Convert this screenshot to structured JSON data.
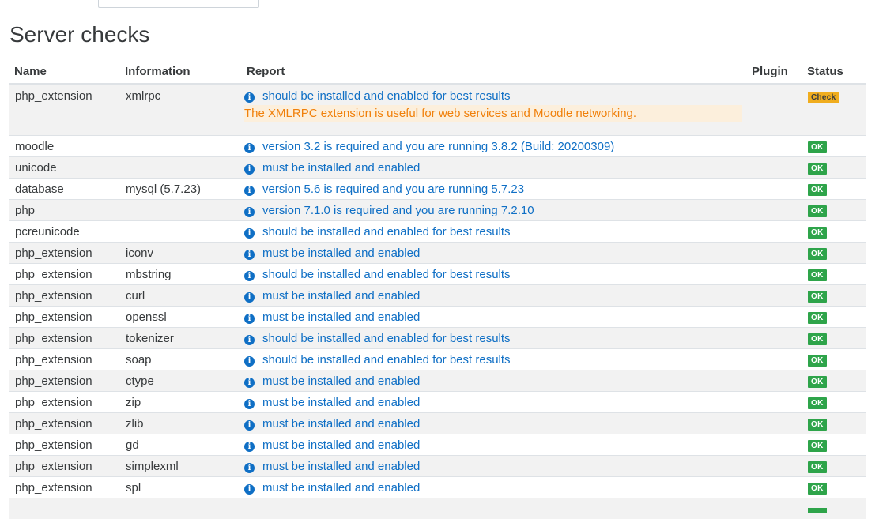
{
  "top": {
    "select_text": ""
  },
  "page_title": "Server checks",
  "table": {
    "headers": {
      "name": "Name",
      "information": "Information",
      "report": "Report",
      "plugin": "Plugin",
      "status": "Status"
    },
    "rows": [
      {
        "name": "php_extension",
        "information": "xmlrpc",
        "report": "should be installed and enabled for best results",
        "note": "The XMLRPC extension is useful for web services and Moodle networking.",
        "status": "Check"
      },
      {
        "name": "moodle",
        "information": "",
        "report": "version 3.2 is required and you are running 3.8.2 (Build: 20200309)",
        "status": "OK"
      },
      {
        "name": "unicode",
        "information": "",
        "report": "must be installed and enabled",
        "status": "OK"
      },
      {
        "name": "database",
        "information": "mysql (5.7.23)",
        "report": "version 5.6 is required and you are running 5.7.23",
        "status": "OK"
      },
      {
        "name": "php",
        "information": "",
        "report": "version 7.1.0 is required and you are running 7.2.10",
        "status": "OK"
      },
      {
        "name": "pcreunicode",
        "information": "",
        "report": "should be installed and enabled for best results",
        "status": "OK"
      },
      {
        "name": "php_extension",
        "information": "iconv",
        "report": "must be installed and enabled",
        "status": "OK"
      },
      {
        "name": "php_extension",
        "information": "mbstring",
        "report": "should be installed and enabled for best results",
        "status": "OK"
      },
      {
        "name": "php_extension",
        "information": "curl",
        "report": "must be installed and enabled",
        "status": "OK"
      },
      {
        "name": "php_extension",
        "information": "openssl",
        "report": "must be installed and enabled",
        "status": "OK"
      },
      {
        "name": "php_extension",
        "information": "tokenizer",
        "report": "should be installed and enabled for best results",
        "status": "OK"
      },
      {
        "name": "php_extension",
        "information": "soap",
        "report": "should be installed and enabled for best results",
        "status": "OK"
      },
      {
        "name": "php_extension",
        "information": "ctype",
        "report": "must be installed and enabled",
        "status": "OK"
      },
      {
        "name": "php_extension",
        "information": "zip",
        "report": "must be installed and enabled",
        "status": "OK"
      },
      {
        "name": "php_extension",
        "information": "zlib",
        "report": "must be installed and enabled",
        "status": "OK"
      },
      {
        "name": "php_extension",
        "information": "gd",
        "report": "must be installed and enabled",
        "status": "OK"
      },
      {
        "name": "php_extension",
        "information": "simplexml",
        "report": "must be installed and enabled",
        "status": "OK"
      },
      {
        "name": "php_extension",
        "information": "spl",
        "report": "must be installed and enabled",
        "status": "OK"
      }
    ]
  },
  "icons": {
    "report_info": "info-circle-icon"
  },
  "colors": {
    "ok": "#2ea44a",
    "check": "#f0ad1e",
    "link": "#0f6fc5",
    "warning_text": "#f0800b",
    "warning_bg": "#fcefdc"
  }
}
